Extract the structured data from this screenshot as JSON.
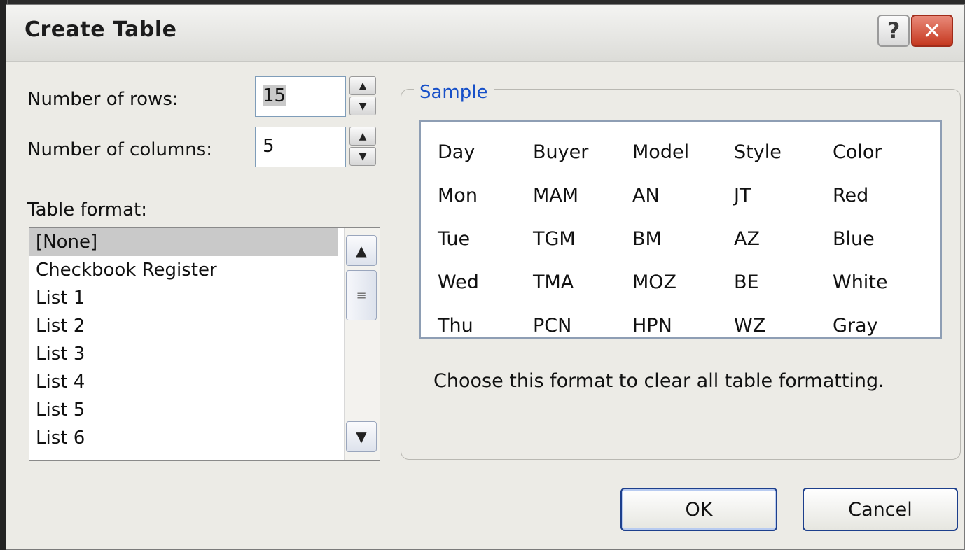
{
  "dialog": {
    "title": "Create Table",
    "help_label": "?",
    "close_label": "✕"
  },
  "rows_field": {
    "label": "Number of rows:",
    "value": "15"
  },
  "cols_field": {
    "label": "Number of columns:",
    "value": "5"
  },
  "spin": {
    "up": "▲",
    "down": "▼"
  },
  "table_format": {
    "label": "Table format:",
    "items": [
      "[None]",
      "Checkbook Register",
      "List 1",
      "List 2",
      "List 3",
      "List 4",
      "List 5",
      "List 6"
    ],
    "selected_index": 0,
    "scroll_up": "▲",
    "scroll_down": "▼",
    "thumb_glyph": "≡"
  },
  "sample": {
    "legend": "Sample",
    "rows": [
      [
        "Day",
        "Buyer",
        "Model",
        "Style",
        "Color"
      ],
      [
        "Mon",
        "MAM",
        "AN",
        "JT",
        "Red"
      ],
      [
        "Tue",
        "TGM",
        "BM",
        "AZ",
        "Blue"
      ],
      [
        "Wed",
        "TMA",
        "MOZ",
        "BE",
        "White"
      ],
      [
        "Thu",
        "PCN",
        "HPN",
        "WZ",
        "Gray"
      ]
    ],
    "description": "Choose this format to clear all table formatting."
  },
  "buttons": {
    "ok": "OK",
    "cancel": "Cancel"
  },
  "colors": {
    "accent": "#1750c8",
    "close": "#c5381f",
    "selection": "#c9c9c9"
  }
}
